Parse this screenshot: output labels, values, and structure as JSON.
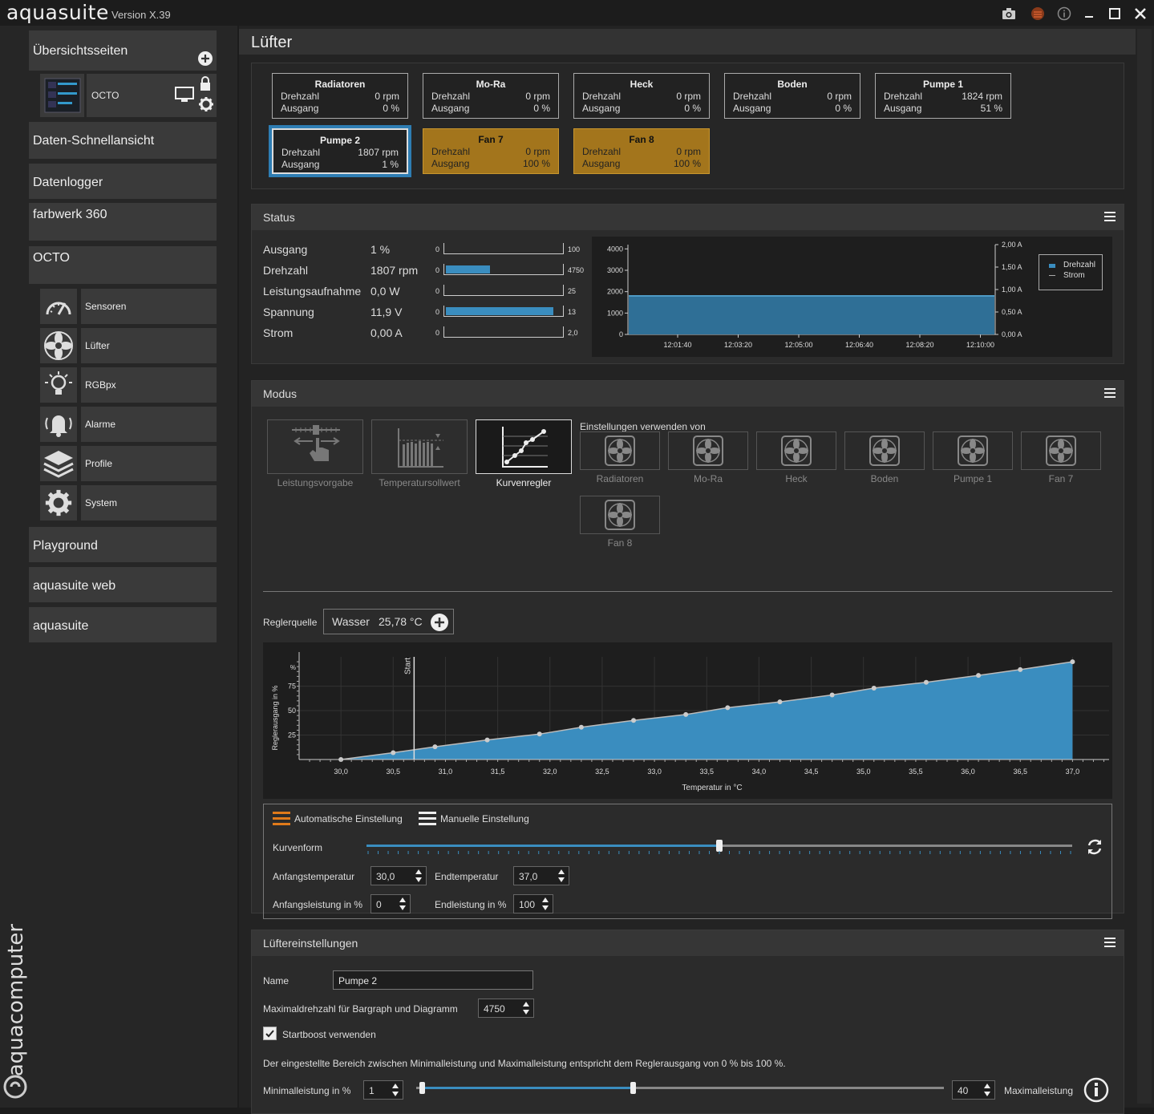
{
  "app": {
    "title": "aquasuite",
    "version": "Version X.39"
  },
  "titlebar_icons": [
    "camera-icon",
    "chip-icon",
    "info-icon",
    "minimize-icon",
    "maximize-icon",
    "close-icon"
  ],
  "sidebar": {
    "overview_label": "Übersichtsseiten",
    "device_tile": {
      "name": "OCTO"
    },
    "items": [
      {
        "label": "Daten-Schnellansicht"
      },
      {
        "label": "Datenlogger"
      },
      {
        "label": "farbwerk 360"
      },
      {
        "label": "OCTO"
      }
    ],
    "sub_items": [
      {
        "label": "Sensoren",
        "icon": "gauge-icon"
      },
      {
        "label": "Lüfter",
        "icon": "fan-icon"
      },
      {
        "label": "RGBpx",
        "icon": "bulb-icon"
      },
      {
        "label": "Alarme",
        "icon": "bell-icon"
      },
      {
        "label": "Profile",
        "icon": "layers-icon"
      },
      {
        "label": "System",
        "icon": "gear-icon"
      }
    ],
    "bottom_items": [
      {
        "label": "Playground"
      },
      {
        "label": "aquasuite web"
      },
      {
        "label": "aquasuite"
      }
    ],
    "brand": "aquacomputer"
  },
  "page": {
    "title": "Lüfter"
  },
  "fan_cards": [
    {
      "title": "Radiatoren",
      "speed": "0 rpm",
      "output": "0 %",
      "state": "normal"
    },
    {
      "title": "Mo-Ra",
      "speed": "0 rpm",
      "output": "0 %",
      "state": "normal"
    },
    {
      "title": "Heck",
      "speed": "0 rpm",
      "output": "0 %",
      "state": "normal"
    },
    {
      "title": "Boden",
      "speed": "0 rpm",
      "output": "0 %",
      "state": "normal"
    },
    {
      "title": "Pumpe 1",
      "speed": "1824 rpm",
      "output": "51 %",
      "state": "normal"
    },
    {
      "title": "Pumpe 2",
      "speed": "1807 rpm",
      "output": "1 %",
      "state": "selected"
    },
    {
      "title": "Fan 7",
      "speed": "0 rpm",
      "output": "100 %",
      "state": "warning"
    },
    {
      "title": "Fan 8",
      "speed": "0 rpm",
      "output": "100 %",
      "state": "warning"
    }
  ],
  "card_labels": {
    "speed": "Drehzahl",
    "output": "Ausgang"
  },
  "status": {
    "header": "Status",
    "rows": [
      {
        "name": "Ausgang",
        "value": "1 %",
        "min": "0",
        "max": "100",
        "fraction": 0.0
      },
      {
        "name": "Drehzahl",
        "value": "1807 rpm",
        "min": "0",
        "max": "4750",
        "fraction": 0.38
      },
      {
        "name": "Leistungsaufnahme",
        "value": "0,0 W",
        "min": "0",
        "max": "25",
        "fraction": 0.0
      },
      {
        "name": "Spannung",
        "value": "11,9 V",
        "min": "0",
        "max": "13",
        "fraction": 0.915
      },
      {
        "name": "Strom",
        "value": "0,00 A",
        "min": "0",
        "max": "2,0",
        "fraction": 0.0
      }
    ],
    "chart": {
      "left_ticks": [
        "4000",
        "3000",
        "2000",
        "1000",
        "0"
      ],
      "right_ticks": [
        "2,00 A",
        "1,50 A",
        "1,00 A",
        "0,50 A",
        "0,00 A"
      ],
      "x_ticks": [
        "12:01:40",
        "12:03:20",
        "12:05:00",
        "12:06:40",
        "12:08:20",
        "12:10:00"
      ],
      "legend": [
        "Drehzahl",
        "Strom"
      ],
      "drehzahl_value": 1807,
      "ylim": [
        0,
        4200
      ],
      "series_color": "#3a8dbf"
    }
  },
  "modus": {
    "header": "Modus",
    "modes": [
      {
        "label": "Leistungsvorgabe",
        "active": false
      },
      {
        "label": "Temperatursollwert",
        "active": false
      },
      {
        "label": "Kurvenregler",
        "active": true
      }
    ],
    "settings_from_label": "Einstellungen verwenden von",
    "sources": [
      "Radiatoren",
      "Mo-Ra",
      "Heck",
      "Boden",
      "Pumpe 1",
      "Fan 7",
      "Fan 8"
    ],
    "regler_label": "Reglerquelle",
    "regler_source": "Wasser",
    "regler_value": "25,78 °C",
    "auto_label": "Automatische Einstellung",
    "manual_label": "Manuelle Einstellung",
    "curve_label": "Kurvenform",
    "curve_fraction": 0.5,
    "start_temp_label": "Anfangstemperatur",
    "start_temp": "30,0",
    "end_temp_label": "Endtemperatur",
    "end_temp": "37,0",
    "start_power_label": "Anfangsleistung in %",
    "start_power": "0",
    "end_power_label": "Endleistung in %",
    "end_power": "100"
  },
  "chart_data": {
    "type": "area",
    "xlabel": "Temperatur in °C",
    "ylabel": "Reglerausgang in %",
    "marker_label": "Start",
    "marker_x": 30.7,
    "x_ticks": [
      "30,0",
      "30,5",
      "31,0",
      "31,5",
      "32,0",
      "32,5",
      "33,0",
      "33,5",
      "34,0",
      "34,5",
      "35,0",
      "35,5",
      "36,0",
      "36,5",
      "37,0"
    ],
    "y_ticks": [
      "25",
      "50",
      "75",
      "%"
    ],
    "xlim": [
      29.6,
      37.35
    ],
    "ylim": [
      0,
      105
    ],
    "x": [
      30.0,
      30.5,
      30.9,
      31.4,
      31.9,
      32.3,
      32.8,
      33.3,
      33.7,
      34.2,
      34.7,
      35.1,
      35.6,
      36.1,
      36.5,
      37.0
    ],
    "y": [
      0,
      7,
      13,
      20,
      26,
      33,
      40,
      46,
      53,
      59,
      66,
      73,
      79,
      86,
      92,
      100
    ],
    "color": "#3a8dbf"
  },
  "fan_settings": {
    "header": "Lüftereinstellungen",
    "name_label": "Name",
    "name_value": "Pumpe 2",
    "maxrpm_label": "Maximaldrehzahl für Bargraph und Diagramm",
    "maxrpm_value": "4750",
    "startboost_label": "Startboost verwenden",
    "startboost_checked": true,
    "range_text": "Der eingestellte Bereich zwischen Minimalleistung und Maximalleistung entspricht dem Reglerausgang von 0 % bis 100 %.",
    "min_label": "Minimalleistung in %",
    "min_value": "1",
    "max_value": "40",
    "max_label": "Maximalleistung",
    "min_fraction": 0.01,
    "max_fraction": 0.4
  }
}
